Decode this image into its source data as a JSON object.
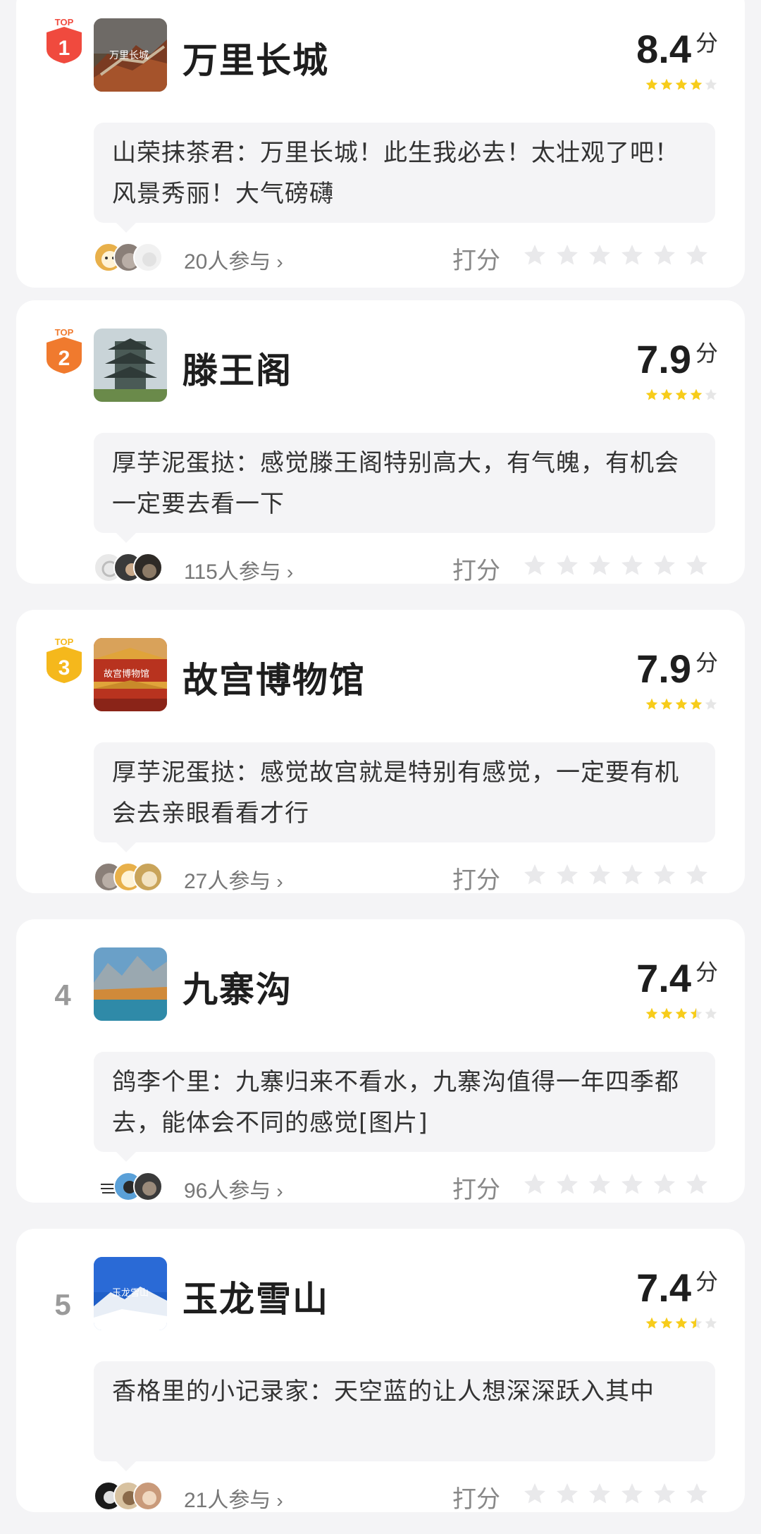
{
  "ranking": {
    "score_unit": "分",
    "rate_label": "打分",
    "top_label": "TOP",
    "colors": {
      "star_filled": "#f7cc1a",
      "star_empty": "#e6e6e6",
      "top1": "#f04a3e",
      "top2": "#f07a2e",
      "top3": "#f5b81c",
      "rank_gray": "#9a9a9a"
    },
    "items": [
      {
        "rank": "1",
        "name": "万里长城",
        "score": "8.4",
        "stars": 4,
        "comment": "山荣抹茶君：万里长城！此生我必去！太壮观了吧！风景秀丽！大气磅礴",
        "participants": "20人参与",
        "thumb_text": "万里长城"
      },
      {
        "rank": "2",
        "name": "滕王阁",
        "score": "7.9",
        "stars": 4,
        "comment": "厚芋泥蛋挞：感觉滕王阁特别高大，有气魄，有机会一定要去看一下",
        "participants": "115人参与",
        "thumb_text": ""
      },
      {
        "rank": "3",
        "name": "故宫博物馆",
        "score": "7.9",
        "stars": 4,
        "comment": "厚芋泥蛋挞：感觉故宫就是特别有感觉，一定要有机会去亲眼看看才行",
        "participants": "27人参与",
        "thumb_text": "故宫博物馆"
      },
      {
        "rank": "4",
        "name": "九寨沟",
        "score": "7.4",
        "stars": 3.5,
        "comment": "鸽李个里：九寨归来不看水，九寨沟值得一年四季都去，能体会不同的感觉[图片]",
        "participants": "96人参与",
        "thumb_text": ""
      },
      {
        "rank": "5",
        "name": "玉龙雪山",
        "score": "7.4",
        "stars": 3.5,
        "comment": "香格里的小记录家：天空蓝的让人想深深跃入其中",
        "participants": "21人参与",
        "thumb_text": "玉龙雪山"
      }
    ]
  }
}
